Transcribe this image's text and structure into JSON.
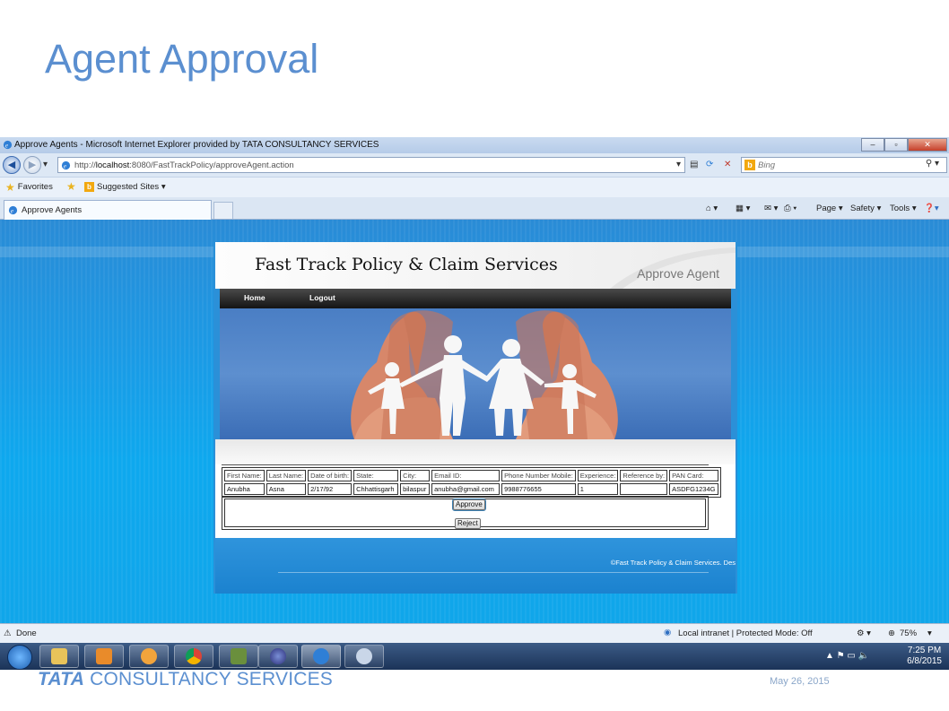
{
  "slide": {
    "title": "Agent Approval",
    "footer_logo_bold": "TATA",
    "footer_logo_rest": " CONSULTANCY SERVICES",
    "date": "May 26, 2015"
  },
  "browser": {
    "window_title": "Approve Agents - Microsoft Internet Explorer provided by TATA CONSULTANCY SERVICES",
    "address_prefix": "http://",
    "address_host": "localhost",
    "address_rest": ":8080/FastTrackPolicy/approveAgent.action",
    "search_placeholder": "Bing",
    "favorites_label": "Favorites",
    "suggested_sites_label": "Suggested Sites ▾",
    "tab_label": "Approve Agents",
    "cmd_page": "Page ▾",
    "cmd_safety": "Safety ▾",
    "cmd_tools": "Tools ▾",
    "status_text": "Done",
    "zone_text": "Local intranet | Protected Mode: Off",
    "zoom_text": "75%"
  },
  "taskbar": {
    "time": "7:25 PM",
    "date": "6/8/2015"
  },
  "webpage": {
    "brand": "Fast Track Policy & Claim Services",
    "page_title": "Approve Agent",
    "nav": {
      "home": "Home",
      "logout": "Logout"
    },
    "table": {
      "headers": [
        "First Name:",
        "Last Name:",
        "Date of birth:",
        "State:",
        "City:",
        "Email ID:",
        "Phone Number Mobile:",
        "Experience:",
        "Reference by:",
        "PAN Card:"
      ],
      "row": [
        "Anubha",
        "Asna",
        "2/17/92",
        "Chhattisgarh",
        "bilaspur",
        "anubha@gmail.com",
        "9988776655",
        "1",
        "",
        "ASDFG1234G"
      ]
    },
    "approve_label": "Approve",
    "reject_label": "Reject",
    "footer_copy": "©Fast Track Policy & Claim Services. Des"
  }
}
